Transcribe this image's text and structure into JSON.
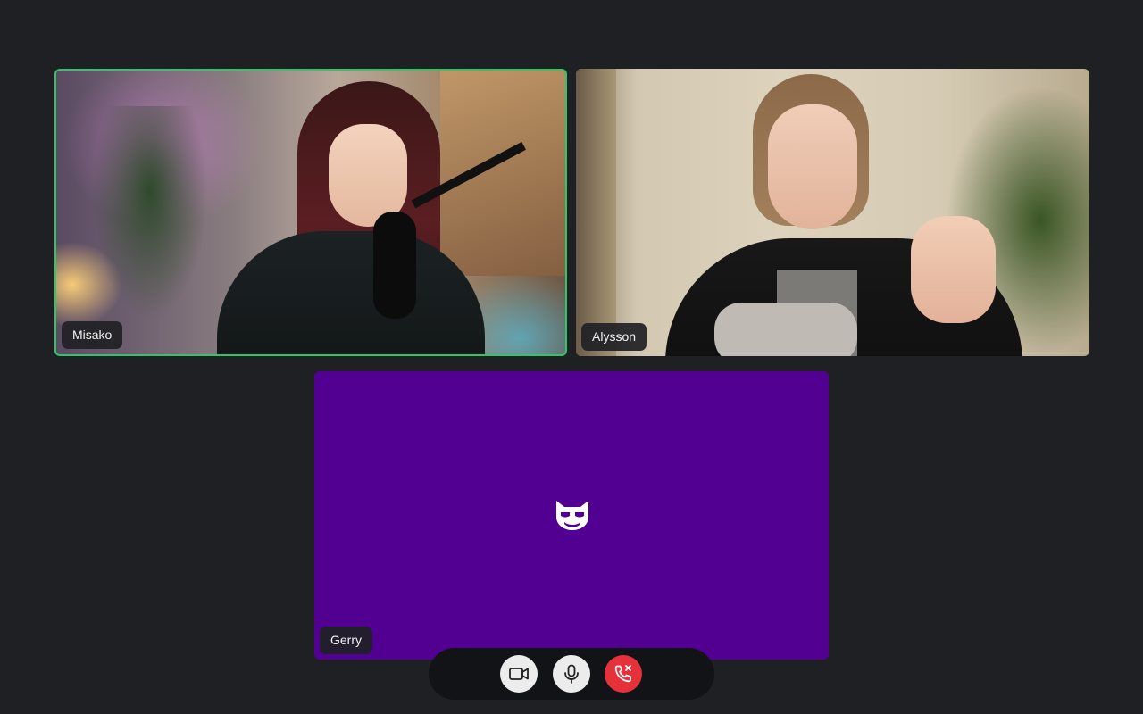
{
  "participants": [
    {
      "name": "Misako",
      "active_speaker": true,
      "video": "on"
    },
    {
      "name": "Alysson",
      "active_speaker": false,
      "video": "on"
    },
    {
      "name": "Gerry",
      "active_speaker": false,
      "video": "off",
      "avatar_icon": "cat-avatar-icon",
      "tile_color": "#520091"
    }
  ],
  "controls": {
    "camera_icon": "video-camera-icon",
    "mic_icon": "microphone-icon",
    "end_call_icon": "phone-hangup-icon"
  },
  "colors": {
    "background": "#1f2023",
    "active_speaker_border": "#2ec766",
    "end_call": "#e6313a",
    "control_button": "#ececec"
  }
}
